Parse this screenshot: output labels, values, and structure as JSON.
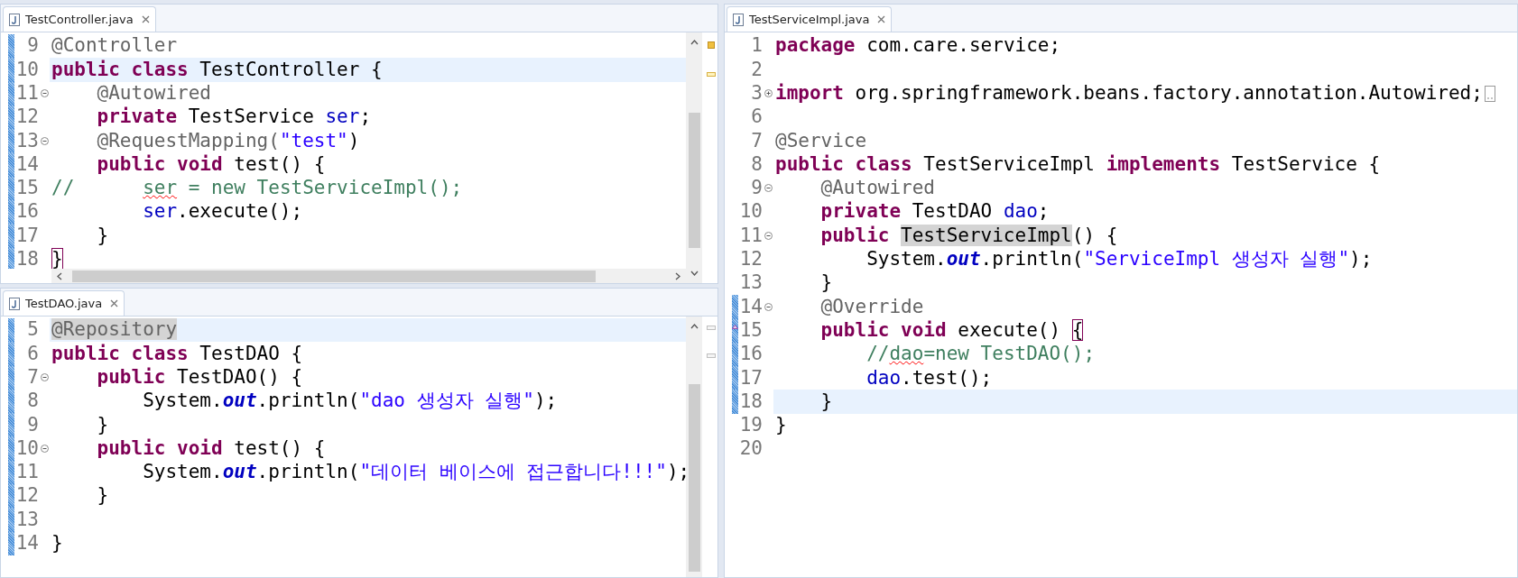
{
  "editors": [
    {
      "tab": "TestController.java",
      "overview_marks": [
        {
          "kind": "task"
        },
        {
          "kind": "occurrence"
        }
      ],
      "scroll": {
        "vertical": true,
        "horizontal": true
      },
      "lines": [
        {
          "number": "9",
          "foldable": false,
          "collapsed": false,
          "changed": true,
          "deleted_marker": false,
          "current": false,
          "tokens": [
            {
              "t": "@Controller",
              "kind": "a"
            }
          ]
        },
        {
          "number": "10",
          "foldable": false,
          "collapsed": false,
          "changed": true,
          "deleted_marker": false,
          "current": true,
          "tokens": [
            {
              "t": "public class",
              "kind": "k"
            },
            {
              "t": " TestController {",
              "kind": "p"
            }
          ]
        },
        {
          "number": "11",
          "foldable": true,
          "collapsed": false,
          "changed": true,
          "deleted_marker": false,
          "current": false,
          "tokens": [
            {
              "t": "    @Autowired",
              "kind": "a"
            }
          ]
        },
        {
          "number": "12",
          "foldable": false,
          "collapsed": false,
          "changed": true,
          "deleted_marker": false,
          "current": false,
          "tokens": [
            {
              "t": "    private",
              "kind": "k"
            },
            {
              "t": " TestService ",
              "kind": "p"
            },
            {
              "t": "ser",
              "kind": "f"
            },
            {
              "t": ";",
              "kind": "p"
            }
          ]
        },
        {
          "number": "13",
          "foldable": true,
          "collapsed": false,
          "changed": true,
          "deleted_marker": false,
          "current": false,
          "tokens": [
            {
              "t": "    @RequestMapping(",
              "kind": "a"
            },
            {
              "t": "\"test\"",
              "kind": "s"
            },
            {
              "t": ")",
              "kind": "p"
            }
          ]
        },
        {
          "number": "14",
          "foldable": false,
          "collapsed": false,
          "changed": true,
          "deleted_marker": false,
          "current": false,
          "tokens": [
            {
              "t": "    public void",
              "kind": "k"
            },
            {
              "t": " test() {",
              "kind": "p"
            }
          ]
        },
        {
          "number": "15",
          "foldable": false,
          "collapsed": false,
          "changed": true,
          "deleted_marker": false,
          "current": false,
          "tokens": [
            {
              "t": "//      ",
              "kind": "c"
            },
            {
              "t": "ser",
              "kind": "ct"
            },
            {
              "t": " = new TestServiceImpl();",
              "kind": "c"
            }
          ]
        },
        {
          "number": "16",
          "foldable": false,
          "collapsed": false,
          "changed": true,
          "deleted_marker": false,
          "current": false,
          "tokens": [
            {
              "t": "        ser",
              "kind": "f"
            },
            {
              "t": ".execute();",
              "kind": "p"
            }
          ]
        },
        {
          "number": "17",
          "foldable": false,
          "collapsed": false,
          "changed": true,
          "deleted_marker": false,
          "current": false,
          "tokens": [
            {
              "t": "    }",
              "kind": "p"
            }
          ]
        },
        {
          "number": "18",
          "foldable": false,
          "collapsed": false,
          "changed": true,
          "deleted_marker": false,
          "current": false,
          "tokens": [
            {
              "t": "}",
              "kind": "b"
            }
          ]
        }
      ]
    },
    {
      "tab": "TestDAO.java",
      "overview_marks": [
        {
          "kind": "occurrence"
        },
        {
          "kind": "occurrence"
        }
      ],
      "scroll": {
        "vertical": true,
        "horizontal": false
      },
      "lines": [
        {
          "number": "5",
          "foldable": false,
          "collapsed": false,
          "changed": true,
          "deleted_marker": false,
          "current": true,
          "tokens": [
            {
              "t": "@Repository",
              "kind": "oa"
            }
          ]
        },
        {
          "number": "6",
          "foldable": false,
          "collapsed": false,
          "changed": true,
          "deleted_marker": false,
          "current": false,
          "tokens": [
            {
              "t": "public class",
              "kind": "k"
            },
            {
              "t": " TestDAO {",
              "kind": "p"
            }
          ]
        },
        {
          "number": "7",
          "foldable": true,
          "collapsed": false,
          "changed": true,
          "deleted_marker": false,
          "current": false,
          "tokens": [
            {
              "t": "    public",
              "kind": "k"
            },
            {
              "t": " TestDAO() {",
              "kind": "p"
            }
          ]
        },
        {
          "number": "8",
          "foldable": false,
          "collapsed": false,
          "changed": true,
          "deleted_marker": false,
          "current": false,
          "tokens": [
            {
              "t": "        System.",
              "kind": "p"
            },
            {
              "t": "out",
              "kind": "st"
            },
            {
              "t": ".println(",
              "kind": "p"
            },
            {
              "t": "\"dao 생성자 실행\"",
              "kind": "s"
            },
            {
              "t": ");",
              "kind": "p"
            }
          ]
        },
        {
          "number": "9",
          "foldable": false,
          "collapsed": false,
          "changed": true,
          "deleted_marker": false,
          "current": false,
          "tokens": [
            {
              "t": "    }",
              "kind": "p"
            }
          ]
        },
        {
          "number": "10",
          "foldable": true,
          "collapsed": false,
          "changed": true,
          "deleted_marker": false,
          "current": false,
          "tokens": [
            {
              "t": "    public void",
              "kind": "k"
            },
            {
              "t": " test() {",
              "kind": "p"
            }
          ]
        },
        {
          "number": "11",
          "foldable": false,
          "collapsed": false,
          "changed": true,
          "deleted_marker": false,
          "current": false,
          "tokens": [
            {
              "t": "        System.",
              "kind": "p"
            },
            {
              "t": "out",
              "kind": "st"
            },
            {
              "t": ".println(",
              "kind": "p"
            },
            {
              "t": "\"데이터 베이스에 접근합니다!!!\"",
              "kind": "s"
            },
            {
              "t": ");",
              "kind": "p"
            }
          ]
        },
        {
          "number": "12",
          "foldable": false,
          "collapsed": false,
          "changed": true,
          "deleted_marker": false,
          "current": false,
          "tokens": [
            {
              "t": "    }",
              "kind": "p"
            }
          ]
        },
        {
          "number": "13",
          "foldable": false,
          "collapsed": false,
          "changed": true,
          "deleted_marker": false,
          "current": false
        },
        {
          "number": "14",
          "foldable": false,
          "collapsed": false,
          "changed": true,
          "deleted_marker": false,
          "current": false,
          "tokens": [
            {
              "t": "}",
              "kind": "p"
            }
          ]
        }
      ]
    },
    {
      "tab": "TestServiceImpl.java",
      "scroll": {
        "vertical": false,
        "horizontal": false
      },
      "lines": [
        {
          "number": "1",
          "foldable": false,
          "collapsed": false,
          "changed": false,
          "deleted_marker": false,
          "current": false,
          "tokens": [
            {
              "t": "package",
              "kind": "k"
            },
            {
              "t": " com.care.service;",
              "kind": "p"
            }
          ]
        },
        {
          "number": "2",
          "foldable": false,
          "collapsed": false,
          "changed": false,
          "deleted_marker": false,
          "current": false
        },
        {
          "number": "3",
          "foldable": true,
          "collapsed": true,
          "changed": false,
          "deleted_marker": false,
          "current": false,
          "tokens": [
            {
              "t": "import",
              "kind": "k"
            },
            {
              "t": " org.springframework.beans.factory.annotation.Autowired;",
              "kind": "p"
            }
          ]
        },
        {
          "number": "6",
          "foldable": false,
          "collapsed": false,
          "changed": false,
          "deleted_marker": false,
          "current": false
        },
        {
          "number": "7",
          "foldable": false,
          "collapsed": false,
          "changed": false,
          "deleted_marker": false,
          "current": false,
          "tokens": [
            {
              "t": "@Service",
              "kind": "a"
            }
          ]
        },
        {
          "number": "8",
          "foldable": false,
          "collapsed": false,
          "changed": false,
          "deleted_marker": false,
          "current": false,
          "tokens": [
            {
              "t": "public class",
              "kind": "k"
            },
            {
              "t": " TestServiceImpl ",
              "kind": "p"
            },
            {
              "t": "implements",
              "kind": "k"
            },
            {
              "t": " TestService {",
              "kind": "p"
            }
          ]
        },
        {
          "number": "9",
          "foldable": true,
          "collapsed": false,
          "changed": false,
          "deleted_marker": false,
          "current": false,
          "tokens": [
            {
              "t": "    @Autowired",
              "kind": "a"
            }
          ]
        },
        {
          "number": "10",
          "foldable": false,
          "collapsed": false,
          "changed": false,
          "deleted_marker": false,
          "current": false,
          "tokens": [
            {
              "t": "    private",
              "kind": "k"
            },
            {
              "t": " TestDAO ",
              "kind": "p"
            },
            {
              "t": "dao",
              "kind": "f"
            },
            {
              "t": ";",
              "kind": "p"
            }
          ]
        },
        {
          "number": "11",
          "foldable": true,
          "collapsed": false,
          "changed": false,
          "deleted_marker": false,
          "current": false,
          "tokens": [
            {
              "t": "    public ",
              "kind": "k"
            },
            {
              "t": "TestServiceImpl",
              "kind": "o"
            },
            {
              "t": "() {",
              "kind": "p"
            }
          ]
        },
        {
          "number": "12",
          "foldable": false,
          "collapsed": false,
          "changed": false,
          "deleted_marker": false,
          "current": false,
          "tokens": [
            {
              "t": "        System.",
              "kind": "p"
            },
            {
              "t": "out",
              "kind": "st"
            },
            {
              "t": ".println(",
              "kind": "p"
            },
            {
              "t": "\"ServiceImpl 생성자 실행\"",
              "kind": "s"
            },
            {
              "t": ");",
              "kind": "p"
            }
          ]
        },
        {
          "number": "13",
          "foldable": false,
          "collapsed": false,
          "changed": false,
          "deleted_marker": false,
          "current": false,
          "tokens": [
            {
              "t": "    }",
              "kind": "p"
            }
          ]
        },
        {
          "number": "14",
          "foldable": true,
          "collapsed": false,
          "changed": true,
          "deleted_marker": false,
          "current": false,
          "tokens": [
            {
              "t": "    @Override",
              "kind": "a"
            }
          ]
        },
        {
          "number": "15",
          "foldable": false,
          "collapsed": false,
          "changed": true,
          "deleted_marker": true,
          "current": false,
          "tokens": [
            {
              "t": "    public void",
              "kind": "k"
            },
            {
              "t": " execute() ",
              "kind": "p"
            },
            {
              "t": "{",
              "kind": "b"
            }
          ]
        },
        {
          "number": "16",
          "foldable": false,
          "collapsed": false,
          "changed": true,
          "deleted_marker": false,
          "current": false,
          "tokens": [
            {
              "t": "        //",
              "kind": "c"
            },
            {
              "t": "dao",
              "kind": "ct"
            },
            {
              "t": "=new TestDAO();",
              "kind": "c"
            }
          ]
        },
        {
          "number": "17",
          "foldable": false,
          "collapsed": false,
          "changed": true,
          "deleted_marker": false,
          "current": false,
          "tokens": [
            {
              "t": "        dao",
              "kind": "f"
            },
            {
              "t": ".test();",
              "kind": "p"
            }
          ]
        },
        {
          "number": "18",
          "foldable": false,
          "collapsed": false,
          "changed": true,
          "deleted_marker": false,
          "current": true,
          "tokens": [
            {
              "t": "    }",
              "kind": "p"
            }
          ]
        },
        {
          "number": "19",
          "foldable": false,
          "collapsed": false,
          "changed": false,
          "deleted_marker": false,
          "current": false,
          "tokens": [
            {
              "t": "}",
              "kind": "p"
            }
          ]
        },
        {
          "number": "20",
          "foldable": false,
          "collapsed": false,
          "changed": false,
          "deleted_marker": false,
          "current": false
        }
      ]
    }
  ]
}
